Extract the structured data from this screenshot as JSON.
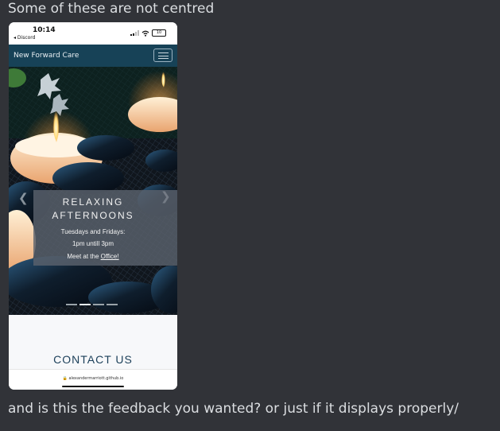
{
  "messages": {
    "top": "Some of these are not centred",
    "bottom": "and is this the feedback you wanted? or just if it displays properly/"
  },
  "phone": {
    "status": {
      "time": "10:14",
      "back_app": "◂ Discord",
      "battery": "10"
    },
    "navbar": {
      "brand": "New Forward Care"
    },
    "carousel": {
      "caption_title": "RELAXING AFTERNOONS",
      "caption_line1": "Tuesdays and Fridays:",
      "caption_line2": "1pm untill 3pm",
      "caption_line3_prefix": "Meet at the ",
      "caption_line3_link": "Office!",
      "indicators": [
        false,
        true,
        false,
        false
      ],
      "prev_icon": "chevron-left-icon",
      "next_icon": "chevron-right-icon"
    },
    "contact_heading": "CONTACT US",
    "url": "alexandermarriott.github.io"
  },
  "colors": {
    "discord_bg": "#313338",
    "navbar_bg": "#174257",
    "heading": "#1b3f59"
  }
}
